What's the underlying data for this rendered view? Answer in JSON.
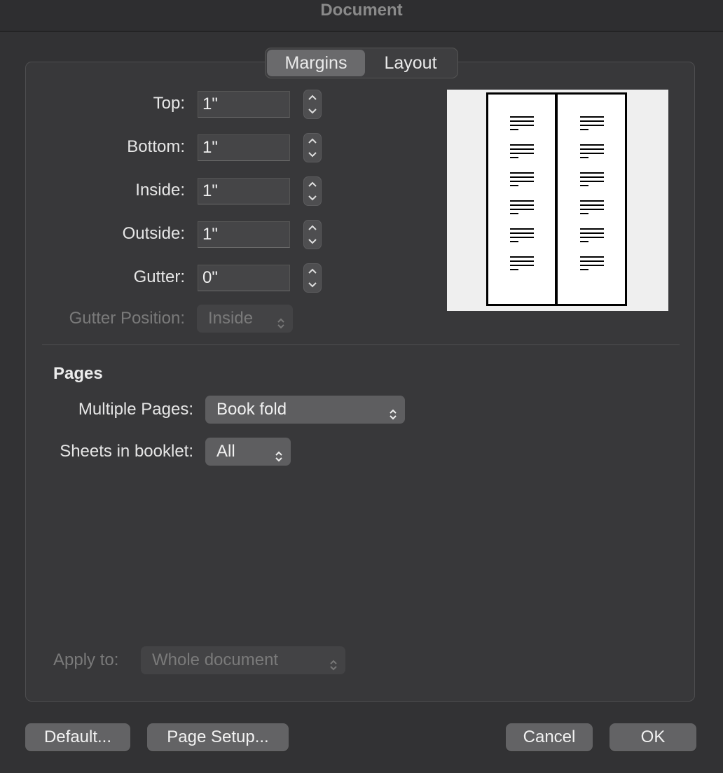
{
  "window": {
    "title": "Document"
  },
  "tabs": [
    {
      "label": "Margins",
      "active": true
    },
    {
      "label": "Layout",
      "active": false
    }
  ],
  "margins": {
    "top_label": "Top:",
    "top_value": "1\"",
    "bottom_label": "Bottom:",
    "bottom_value": "1\"",
    "inside_label": "Inside:",
    "inside_value": "1\"",
    "outside_label": "Outside:",
    "outside_value": "1\"",
    "gutter_label": "Gutter:",
    "gutter_value": "0\"",
    "gutter_position_label": "Gutter Position:",
    "gutter_position_value": "Inside"
  },
  "pages": {
    "section_title": "Pages",
    "multiple_pages_label": "Multiple Pages:",
    "multiple_pages_value": "Book fold",
    "sheets_label": "Sheets in booklet:",
    "sheets_value": "All"
  },
  "apply_to": {
    "label": "Apply to:",
    "value": "Whole document"
  },
  "buttons": {
    "default": "Default...",
    "page_setup": "Page Setup...",
    "cancel": "Cancel",
    "ok": "OK"
  }
}
